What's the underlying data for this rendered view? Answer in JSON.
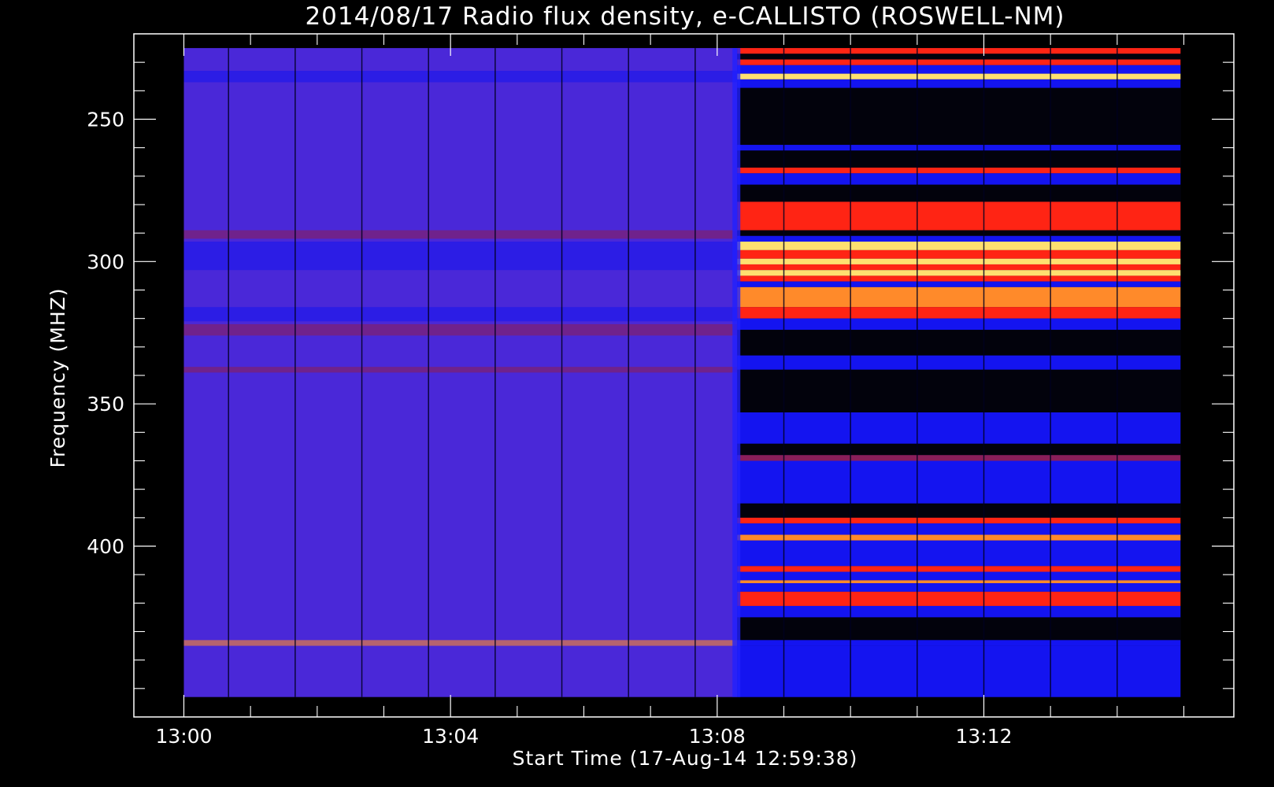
{
  "chart_data": {
    "type": "heatmap",
    "title": "2014/08/17  Radio flux density, e-CALLISTO (ROSWELL-NM)",
    "xlabel": "Start Time (17-Aug-14 12:59:38)",
    "ylabel": "Frequency (MHZ)",
    "x_tick_labels": [
      "13:00",
      "13:04",
      "13:08",
      "13:12"
    ],
    "x_tick_minutes": [
      0,
      4,
      8,
      12
    ],
    "xlim_minutes": [
      -0.75,
      15.75
    ],
    "data_extent_minutes": [
      0,
      14.95
    ],
    "y_tick_values": [
      250,
      300,
      350,
      400
    ],
    "ylim": [
      220,
      460
    ],
    "data_extent_mhz": [
      225,
      453
    ],
    "y_reversed": true,
    "grid": false,
    "colormap": [
      "#000000",
      "#1010ff",
      "#5a22c8",
      "#b02030",
      "#ff2010",
      "#ff9020",
      "#ffe066"
    ],
    "background_colors": {
      "quiet": "#4a28d8",
      "figure": "#000000"
    },
    "burst_onset_minutes": 8.3,
    "quiet_bands": [
      {
        "from": 233,
        "to": 237,
        "level": "blue"
      },
      {
        "from": 289,
        "to": 292,
        "level": "dark-red"
      },
      {
        "from": 293,
        "to": 297,
        "level": "blue"
      },
      {
        "from": 297,
        "to": 303,
        "level": "blue"
      },
      {
        "from": 316,
        "to": 321,
        "level": "blue"
      },
      {
        "from": 322,
        "to": 326,
        "level": "dark-red"
      },
      {
        "from": 337,
        "to": 339,
        "level": "dark-red"
      },
      {
        "from": 433,
        "to": 435,
        "level": "orange"
      }
    ],
    "burst_bands": [
      {
        "from": 225,
        "to": 227,
        "level": "red"
      },
      {
        "from": 227,
        "to": 229,
        "level": "black"
      },
      {
        "from": 229,
        "to": 231,
        "level": "red"
      },
      {
        "from": 231,
        "to": 234,
        "level": "blue"
      },
      {
        "from": 234,
        "to": 236,
        "level": "yellow"
      },
      {
        "from": 236,
        "to": 239,
        "level": "blue"
      },
      {
        "from": 239,
        "to": 259,
        "level": "black"
      },
      {
        "from": 259,
        "to": 261,
        "level": "blue"
      },
      {
        "from": 261,
        "to": 267,
        "level": "black"
      },
      {
        "from": 267,
        "to": 269,
        "level": "red"
      },
      {
        "from": 269,
        "to": 273,
        "level": "blue"
      },
      {
        "from": 273,
        "to": 279,
        "level": "black"
      },
      {
        "from": 279,
        "to": 289,
        "level": "red"
      },
      {
        "from": 289,
        "to": 291,
        "level": "black"
      },
      {
        "from": 291,
        "to": 293,
        "level": "blue"
      },
      {
        "from": 293,
        "to": 296,
        "level": "yellow"
      },
      {
        "from": 296,
        "to": 299,
        "level": "red"
      },
      {
        "from": 299,
        "to": 301,
        "level": "yellow"
      },
      {
        "from": 301,
        "to": 303,
        "level": "red"
      },
      {
        "from": 303,
        "to": 305,
        "level": "yellow"
      },
      {
        "from": 305,
        "to": 307,
        "level": "red"
      },
      {
        "from": 307,
        "to": 309,
        "level": "blue"
      },
      {
        "from": 309,
        "to": 316,
        "level": "orange"
      },
      {
        "from": 316,
        "to": 320,
        "level": "red"
      },
      {
        "from": 320,
        "to": 324,
        "level": "blue"
      },
      {
        "from": 324,
        "to": 333,
        "level": "black"
      },
      {
        "from": 333,
        "to": 338,
        "level": "blue"
      },
      {
        "from": 338,
        "to": 353,
        "level": "black"
      },
      {
        "from": 353,
        "to": 364,
        "level": "blue"
      },
      {
        "from": 364,
        "to": 368,
        "level": "black"
      },
      {
        "from": 368,
        "to": 370,
        "level": "dark-red"
      },
      {
        "from": 370,
        "to": 385,
        "level": "blue"
      },
      {
        "from": 385,
        "to": 390,
        "level": "black"
      },
      {
        "from": 390,
        "to": 392,
        "level": "red"
      },
      {
        "from": 392,
        "to": 396,
        "level": "blue"
      },
      {
        "from": 396,
        "to": 398,
        "level": "orange"
      },
      {
        "from": 398,
        "to": 407,
        "level": "blue"
      },
      {
        "from": 407,
        "to": 409,
        "level": "red"
      },
      {
        "from": 409,
        "to": 412,
        "level": "blue"
      },
      {
        "from": 412,
        "to": 413,
        "level": "orange"
      },
      {
        "from": 413,
        "to": 416,
        "level": "blue"
      },
      {
        "from": 416,
        "to": 421,
        "level": "red"
      },
      {
        "from": 421,
        "to": 425,
        "level": "blue"
      },
      {
        "from": 425,
        "to": 433,
        "level": "black"
      },
      {
        "from": 433,
        "to": 435,
        "level": "blue"
      },
      {
        "from": 435,
        "to": 453,
        "level": "blue"
      }
    ],
    "receiver_gaps_minutes": [
      0.67,
      1.67,
      2.67,
      3.67,
      4.67,
      5.67,
      6.67,
      7.67,
      9.0,
      10.0,
      11.0,
      12.0,
      13.0,
      14.0
    ]
  }
}
